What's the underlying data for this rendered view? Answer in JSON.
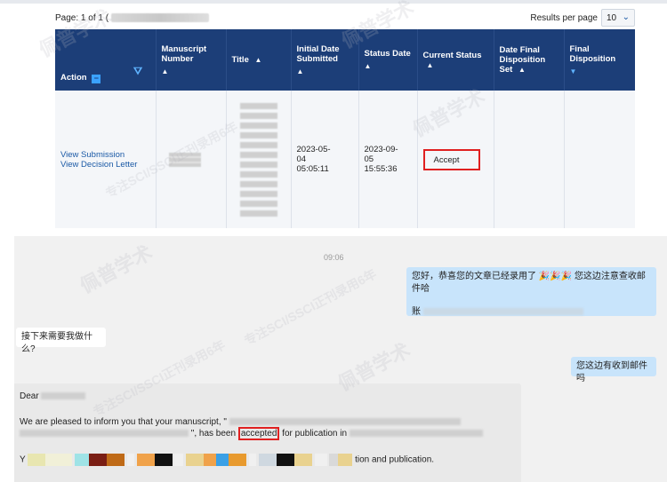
{
  "pager": {
    "page_info": "Page: 1 of 1 (",
    "results_label": "Results per page",
    "per_page_value": "10"
  },
  "table": {
    "headers": {
      "action": "Action",
      "manuscript_number": "Manuscript Number",
      "title": "Title",
      "initial_date": "Initial Date Submitted",
      "status_date": "Status Date",
      "current_status": "Current Status",
      "date_final": "Date Final Disposition Set",
      "final_disposition": "Final Disposition"
    },
    "row": {
      "view_submission": "View Submission",
      "view_decision": "View Decision Letter",
      "initial_date": "2023-05-04 05:05:11",
      "status_date": "2023-09-05 15:55:36",
      "current_status": "Accept"
    }
  },
  "chat": {
    "time": "09:06",
    "msg_right_1_a": "您好，恭喜您的文章已经录用了",
    "msg_right_1_b": "您这边注意查收邮件哈",
    "msg_right_1_line2": "账",
    "msg_left_1": "接下来需要我做什么?",
    "msg_right_2": "您这边有收到邮件吗",
    "email_dear": "Dear",
    "email_p1_a": "We are pleased to inform you that your manuscript, \"",
    "email_p1_b": "\", has been",
    "email_accepted": "accepted",
    "email_p1_c": "for publication in",
    "email_p2_start": "Y",
    "email_p2_end": "tion and publication."
  },
  "watermark": {
    "brand": "佩普学术",
    "tagline": "专注SCI/SSCI正刊录用6年"
  },
  "colors": {
    "header_navy": "#1c3e78",
    "link_blue": "#1b5aa6",
    "highlight_red": "#e02020",
    "chat_bubble_blue": "#c8e4fb"
  }
}
